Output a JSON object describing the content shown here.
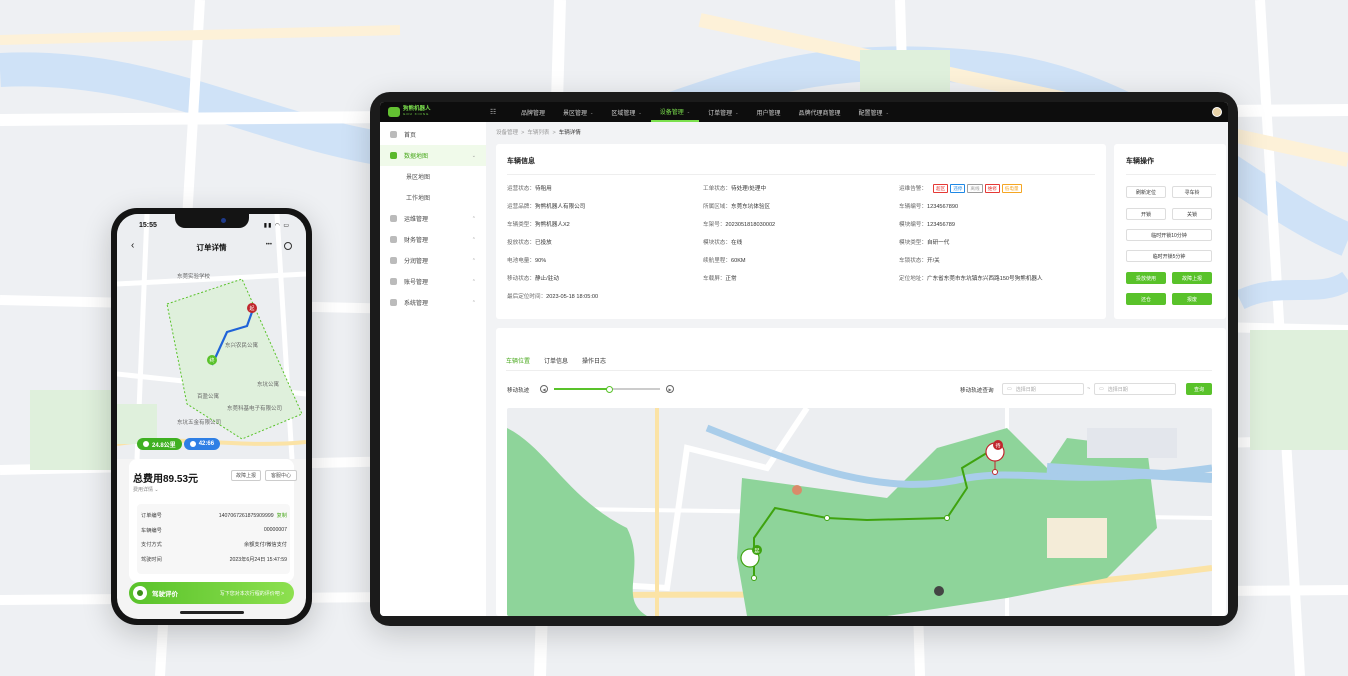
{
  "admin": {
    "nav": {
      "items": [
        {
          "label": "品牌管理",
          "dropdown": false,
          "active": false
        },
        {
          "label": "景区管理",
          "dropdown": true,
          "active": false
        },
        {
          "label": "区域管理",
          "dropdown": true,
          "active": false
        },
        {
          "label": "设备管理",
          "dropdown": true,
          "active": true
        },
        {
          "label": "订单管理",
          "dropdown": true,
          "active": false
        },
        {
          "label": "用户管理",
          "dropdown": false,
          "active": false
        },
        {
          "label": "品牌代理商管理",
          "dropdown": false,
          "active": false
        },
        {
          "label": "配置管理",
          "dropdown": true,
          "active": false
        }
      ]
    },
    "sidebar": {
      "home": "首页",
      "data_map": "数据地图",
      "scenic_map": "景区地图",
      "work_map": "工作地图",
      "ops": "运维管理",
      "finance": "财务管理",
      "profit": "分润管理",
      "account": "账号管理",
      "system": "系统管理"
    },
    "breadcrumb": {
      "a": "设备管理",
      "b": "车辆列表",
      "c": "车辆详情",
      "sep": ">"
    },
    "vehicle": {
      "title": "车辆信息",
      "col1": [
        {
          "k": "运营状态：",
          "v": "待租用"
        },
        {
          "k": "运营品牌：",
          "v": "狗熊机器人有限公司"
        },
        {
          "k": "车辆类型：",
          "v": "狗熊机器人X2"
        },
        {
          "k": "投放状态：",
          "v": "已投放"
        },
        {
          "k": "电池电量：",
          "v": "90%"
        },
        {
          "k": "移动状态：",
          "v": "静止/驻动"
        },
        {
          "k": "最后定位时间：",
          "v": "2023-05-18 18:05:00"
        }
      ],
      "col2": [
        {
          "k": "工单状态：",
          "v": "待处理/处理中"
        },
        {
          "k": "所属区域：",
          "v": "东莞东坑体验区"
        },
        {
          "k": "车架号：",
          "v": "2023051818030002"
        },
        {
          "k": "模块状态：",
          "v": "在线"
        },
        {
          "k": "续航里程：",
          "v": "60KM"
        },
        {
          "k": "车载屏：",
          "v": "正常"
        }
      ],
      "col3": [
        {
          "k": "运维告警：",
          "v": ""
        },
        {
          "k": "车辆编号：",
          "v": "1234567890"
        },
        {
          "k": "模块编号：",
          "v": "123456789"
        },
        {
          "k": "模块类型：",
          "v": "自研一代"
        },
        {
          "k": "车锁状态：",
          "v": "开/关"
        },
        {
          "k": "定位地址：",
          "v": "广东省东莞市东坑镇东兴西路150号狗熊机器人"
        }
      ],
      "alarm_tags": [
        {
          "label": "超区",
          "color": "#e53935"
        },
        {
          "label": "违停",
          "color": "#1e88e5"
        },
        {
          "label": "离线",
          "color": "#9e9e9e"
        },
        {
          "label": "维修",
          "color": "#e53935"
        },
        {
          "label": "低电量",
          "color": "#f5a623"
        }
      ]
    },
    "operations": {
      "title": "车辆操作",
      "refresh": "刷新定位",
      "find": "寻车铃",
      "unlock": "开锁",
      "lock": "关锁",
      "temp10": "临时开锁10分钟",
      "temp5": "临时开锁5分钟",
      "deploy": "投放使用",
      "fault": "故障上报",
      "return": "还仓",
      "scrap": "报废"
    },
    "tabs": [
      {
        "label": "车辆位置",
        "active": true
      },
      {
        "label": "订单信息",
        "active": false
      },
      {
        "label": "操作日志",
        "active": false
      }
    ],
    "track": {
      "label": "移动轨迹",
      "progress": 0.52,
      "query_label": "移动轨迹查询",
      "start_placeholder": "选择日期",
      "end_placeholder": "选择日期",
      "query_btn": "查询",
      "sep": "~"
    },
    "map_markers": [
      {
        "label": "待",
        "kind": "start-pin"
      },
      {
        "label": "起",
        "kind": "end-pin"
      }
    ],
    "colors": {
      "accent": "#59c22a",
      "park": "#7fcf8f",
      "route": "#3fa30f",
      "water": "#a9cdea"
    }
  },
  "phone": {
    "time": "15:55",
    "title": "订单详情",
    "map_start": "起",
    "map_end": "终",
    "map_labels": [
      "东莞实验学校",
      "东兴农民公寓",
      "百盈公寓",
      "东莞科基电子有限公司",
      "东坑五金有限公司",
      "东坑公寓"
    ],
    "distance": "24.8公里",
    "duration": "42:66",
    "total": "总费用89.53元",
    "fee_detail": "费用详情",
    "btn_fault": "故障上报",
    "btn_service": "客服中心",
    "rows": [
      {
        "k": "订单编号",
        "v": "1407067261875909999",
        "copy": "复制"
      },
      {
        "k": "车辆编号",
        "v": "00000007",
        "copy": ""
      },
      {
        "k": "支付方式",
        "v": "余额支付/微信支付",
        "copy": ""
      },
      {
        "k": "驾驶时间",
        "v": "2023年6月24日 15:47:59",
        "copy": ""
      }
    ],
    "rate_title": "驾驶评价",
    "rate_hint": "写下您对本次行程的评价吧 >"
  }
}
